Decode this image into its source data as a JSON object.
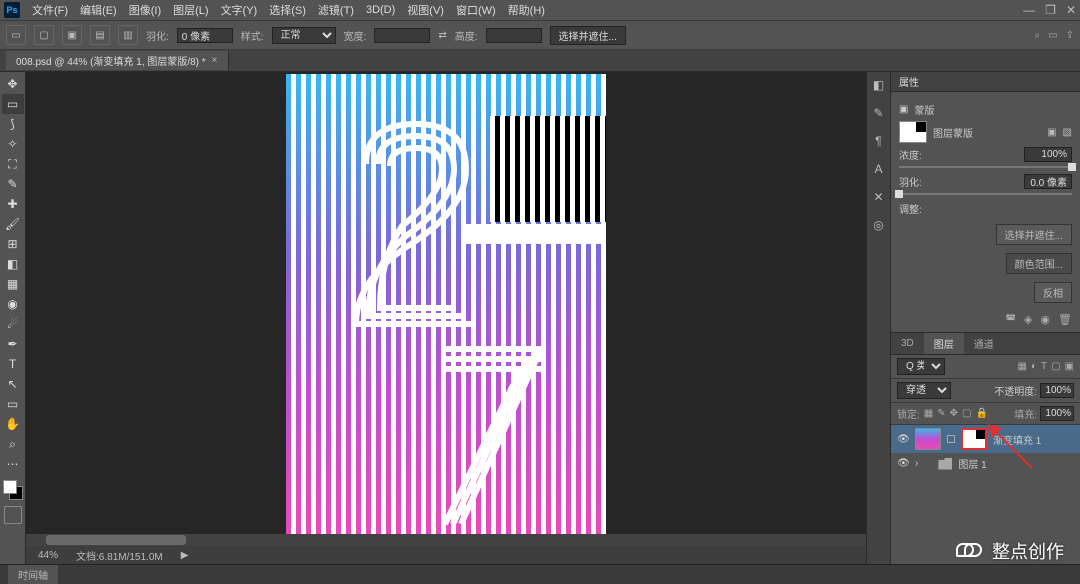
{
  "app": {
    "ps": "Ps"
  },
  "menu": {
    "file": "文件(F)",
    "edit": "编辑(E)",
    "image": "图像(I)",
    "layer": "图层(L)",
    "type": "文字(Y)",
    "select": "选择(S)",
    "filter": "滤镜(T)",
    "threeD": "3D(D)",
    "view": "视图(V)",
    "window": "窗口(W)",
    "help": "帮助(H)"
  },
  "win": {
    "min": "—",
    "restore": "❐",
    "close": "✕"
  },
  "opt": {
    "feather_label": "羽化:",
    "feather_value": "0 像素",
    "style_label": "样式:",
    "style_value": "正常",
    "width_label": "宽度:",
    "height_label": "高度:",
    "select_mask_btn": "选择并遮住..."
  },
  "doc": {
    "tab_title": "008.psd @ 44% (渐变填充 1, 图层蒙版/8) *",
    "close": "×"
  },
  "status": {
    "zoom": "44%",
    "docinfo": "文档:6.81M/151.0M",
    "arrow": "▶"
  },
  "props": {
    "panel_title": "属性",
    "mask_type": "蒙版",
    "mask_label": "图层蒙版",
    "density_label": "浓度:",
    "density_value": "100%",
    "feather_label": "羽化:",
    "feather_value": "0.0 像素",
    "refine_label": "调整:",
    "btn_select_mask": "选择并遮住...",
    "btn_color_range": "颜色范围...",
    "btn_invert": "反相"
  },
  "layers": {
    "tab_3d": "3D",
    "tab_layers": "图层",
    "tab_channels": "通道",
    "filter_type": "Q 类型",
    "blend_mode": "穿透",
    "opacity_label": "不透明度:",
    "opacity_value": "100%",
    "lock_label": "锁定:",
    "fill_label": "填充:",
    "fill_value": "100%",
    "layer1_name": "渐变填充 1",
    "layer2_name": "图层 1"
  },
  "timeline": {
    "tab": "时间轴"
  },
  "watermark": {
    "text": "整点创作"
  },
  "dock": {
    "i1": "◧",
    "i2": "✎",
    "i3": "¶",
    "i4": "A",
    "i5": "✕",
    "i6": "◎"
  }
}
